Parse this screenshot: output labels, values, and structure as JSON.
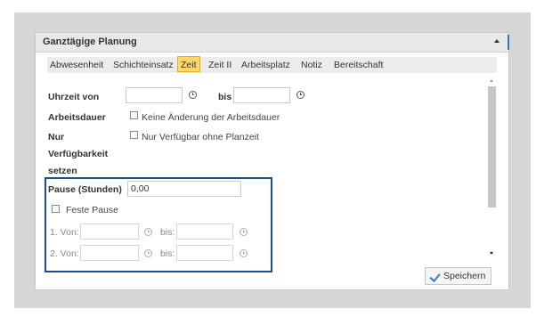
{
  "panel": {
    "title": "Ganztägige Planung"
  },
  "tabs": [
    {
      "label": "Abwesenheit"
    },
    {
      "label": "Schichteinsatz"
    },
    {
      "label": "Zeit",
      "active": true
    },
    {
      "label": "Zeit II"
    },
    {
      "label": "Arbeitsplatz"
    },
    {
      "label": "Notiz"
    },
    {
      "label": "Bereitschaft"
    }
  ],
  "form": {
    "uhrzeit_von_label": "Uhrzeit von",
    "uhrzeit_von_value": "",
    "bis_label": "bis",
    "bis_value": "",
    "arbeitsdauer_label": "Arbeitsdauer",
    "keine_aenderung_label": "Keine Änderung der Arbeitsdauer",
    "keine_aenderung_checked": false,
    "nur_label": "Nur",
    "verfuegbarkeit_label": "Verfügbarkeit",
    "setzen_label": "setzen",
    "nur_verfuegbar_label": "Nur Verfügbar ohne Planzeit",
    "nur_verfuegbar_checked": false,
    "pause_label": "Pause (Stunden)",
    "pause_value": "0,00",
    "feste_pause_label": "Feste Pause",
    "feste_pause_checked": false,
    "von1_label": "1. Von:",
    "von1_value": "",
    "bis1_label": "bis:",
    "bis1_value": "",
    "von2_label": "2. Von:",
    "von2_value": "",
    "bis2_label": "bis:",
    "bis2_value": ""
  },
  "footer": {
    "save_label": "Speichern"
  },
  "colors": {
    "active_tab": "#ffd766",
    "highlight_border": "#1f4e8c",
    "accent": "#3a7bd5"
  },
  "icons": [
    "chevron-up-icon",
    "clock-icon",
    "checkbox-icon",
    "checkmark-icon"
  ]
}
